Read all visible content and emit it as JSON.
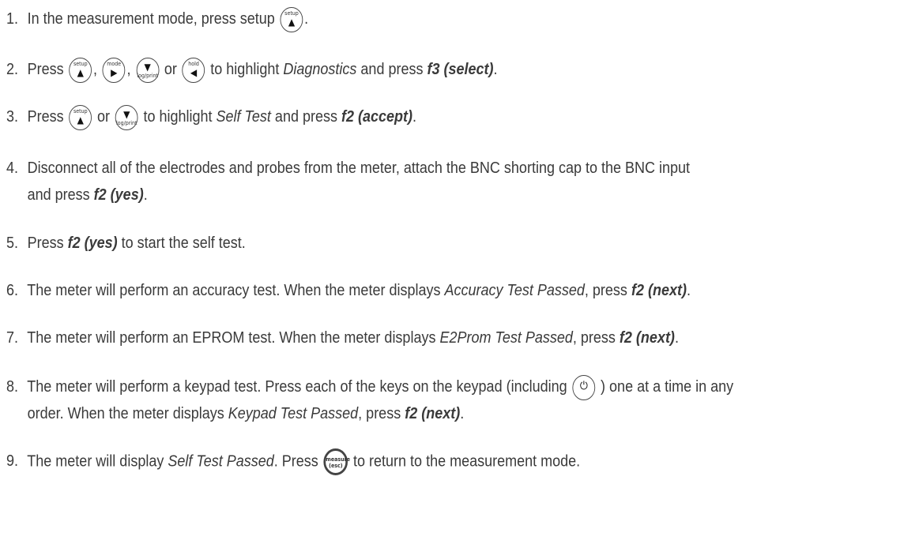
{
  "steps": [
    {
      "num": "1.",
      "a": "In the measurement mode, press setup",
      "b": "."
    },
    {
      "num": "2.",
      "a": "Press",
      "sep1": ",",
      "sep2": ",",
      "or": "or",
      "b": "to highlight",
      "em": "Diagnostics",
      "c": "and press",
      "strong": "f3 (select)",
      "d": "."
    },
    {
      "num": "3.",
      "a": "Press",
      "or": "or",
      "b": "to highlight",
      "em": "Self Test",
      "c": "and press",
      "strong": "f2 (accept)",
      "d": "."
    },
    {
      "num": "4.",
      "a": "Disconnect all of the electrodes and probes from the meter, attach the BNC shorting cap to the BNC input",
      "b": "and press",
      "strong": "f2 (yes)",
      "d": "."
    },
    {
      "num": "5.",
      "a": "Press",
      "strong": "f2 (yes)",
      "b": "to start the self test."
    },
    {
      "num": "6.",
      "a": "The meter will perform an accuracy test. When the meter displays",
      "em": "Accuracy Test Passed",
      "b": ", press",
      "strong": "f2 (next)",
      "d": "."
    },
    {
      "num": "7.",
      "a": "The meter will perform an EPROM test. When the meter displays",
      "em": "E2Prom Test Passed",
      "b": ", press",
      "strong": "f2 (next)",
      "d": "."
    },
    {
      "num": "8.",
      "a": "The meter will perform a keypad test. Press each of the keys on the keypad (including",
      "b": ") one at a time in any",
      "c": "order. When the meter displays",
      "em": "Keypad Test Passed",
      "c2": ", press",
      "strong": "f2 (next)",
      "d": "."
    },
    {
      "num": "9.",
      "a": "The meter will display",
      "em": "Self Test Passed",
      "b": ". Press",
      "c": "to return to the measurement mode."
    }
  ],
  "keys": {
    "setup_label": "setup",
    "mode_label": "mode",
    "log_print_label": "log/print",
    "hold_label": "hold",
    "measure_label": "measure",
    "esc_label": "(esc)",
    "up_icon": "up-arrow-icon",
    "right_icon": "right-arrow-icon",
    "down_icon": "down-arrow-icon",
    "left_icon": "left-arrow-icon",
    "power_icon": "power-backlight-icon"
  }
}
